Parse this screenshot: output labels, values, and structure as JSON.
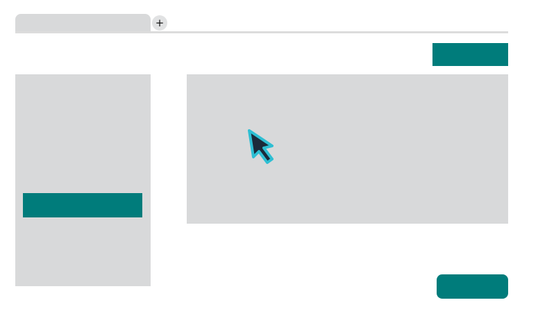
{
  "tabs": {
    "new_tab_symbol": "+"
  },
  "icons": {
    "new_tab": "plus-icon",
    "cursor": "mouse-pointer-icon"
  },
  "colors": {
    "accent": "#007c7b",
    "panel": "#d8d9da",
    "cursor_fill": "#1c2b3a",
    "cursor_outline": "#2ebfd3"
  }
}
